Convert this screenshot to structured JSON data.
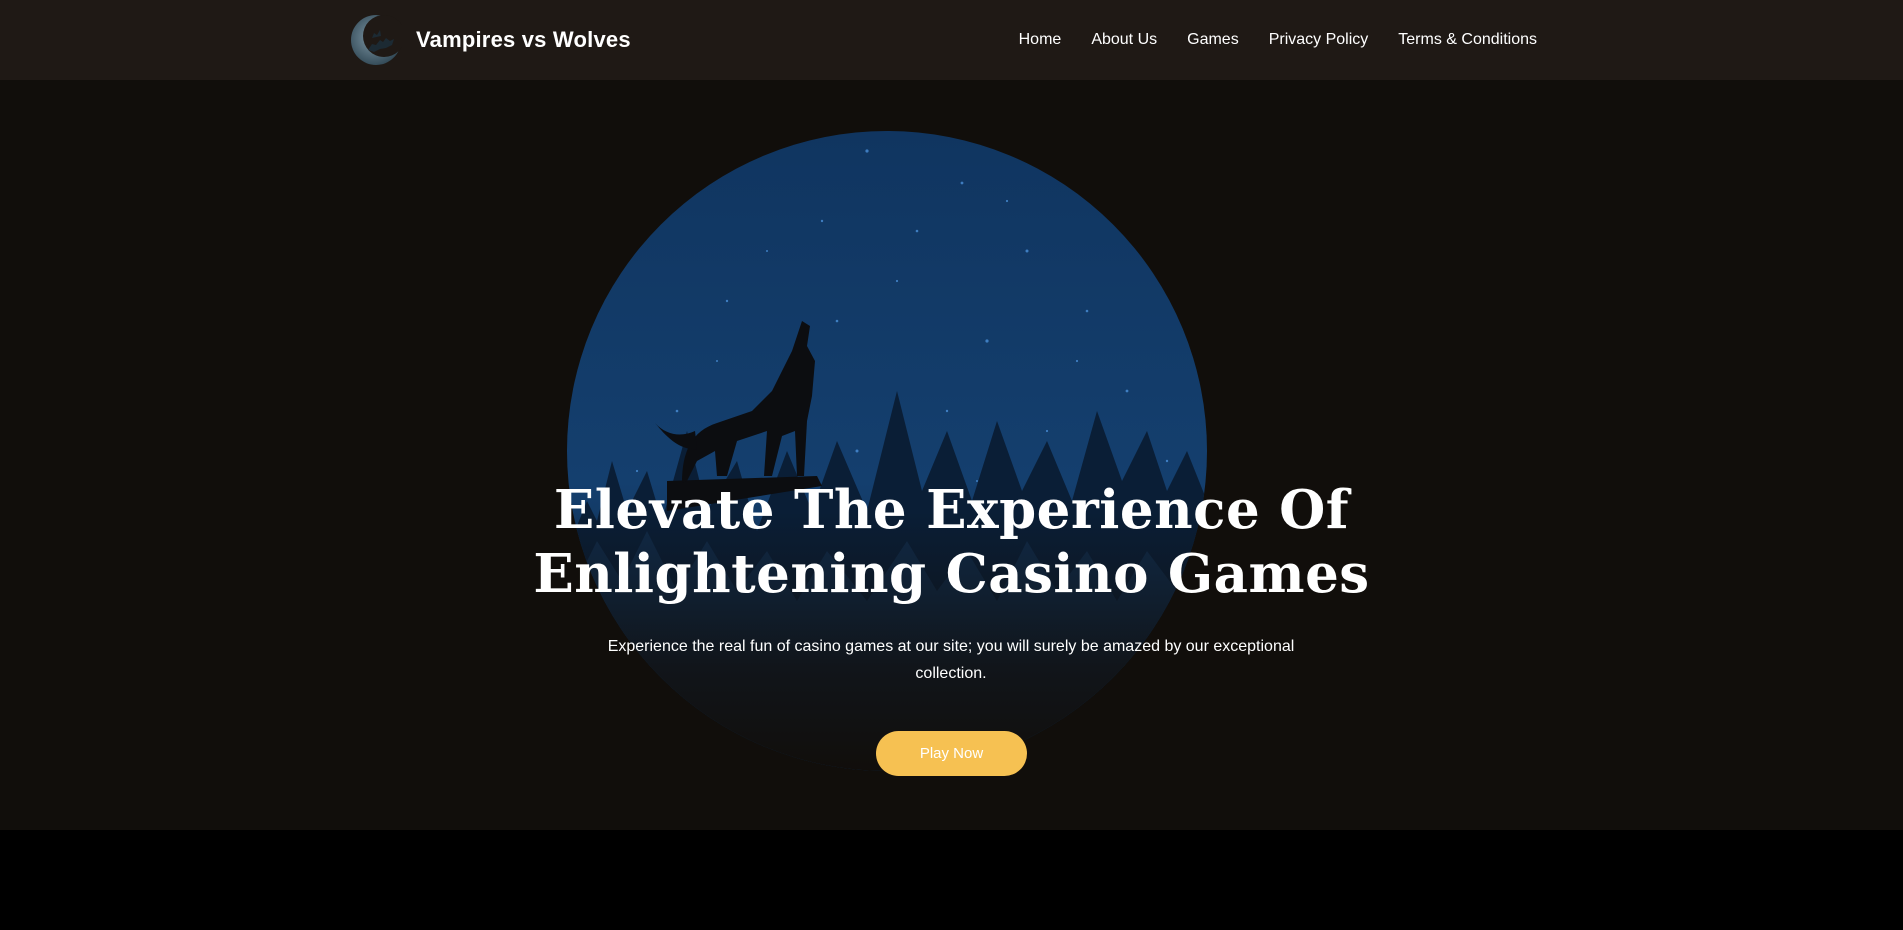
{
  "header": {
    "brand_name": "Vampires vs Wolves",
    "logo_icon": "crescent-moon-wolves-logo-icon",
    "nav": [
      {
        "label": "Home"
      },
      {
        "label": "About Us"
      },
      {
        "label": "Games"
      },
      {
        "label": "Privacy Policy"
      },
      {
        "label": "Terms & Conditions"
      }
    ]
  },
  "hero": {
    "image": "howling-wolf-night-moon-illustration",
    "title_line1": "Elevate The Experience Of",
    "title_line2": "Enlightening Casino Games",
    "subtitle": "Experience the real fun of casino games at our site; you will surely be amazed by our exceptional collection.",
    "cta_label": "Play Now"
  },
  "colors": {
    "header_bg": "#1f1915",
    "hero_bg": "#110e0b",
    "moon_blue": "#133a66",
    "cta_bg": "#f6c152",
    "text": "#ffffff"
  }
}
